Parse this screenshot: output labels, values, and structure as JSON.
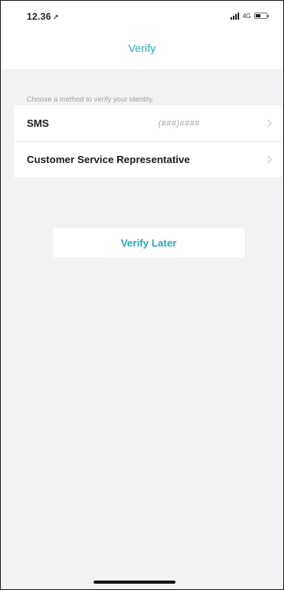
{
  "status_bar": {
    "time": "12.36",
    "location_glyph": "↗",
    "network": "4G",
    "signal_icon": "cellular-signal-icon",
    "battery_icon": "battery-icon"
  },
  "nav": {
    "title": "Verify"
  },
  "instruction": "Choose a method to verify your identity.",
  "options": [
    {
      "label": "SMS",
      "value": "(###)####",
      "icon": "chevron-right-icon"
    },
    {
      "label": "Customer Service Representative",
      "value": "",
      "icon": "chevron-right-icon"
    }
  ],
  "actions": {
    "verify_later": "Verify Later"
  },
  "colors": {
    "accent": "#2aa9b0",
    "background": "#f2f2f4",
    "card": "#ffffff",
    "secondary_text": "#a2a2a6"
  }
}
